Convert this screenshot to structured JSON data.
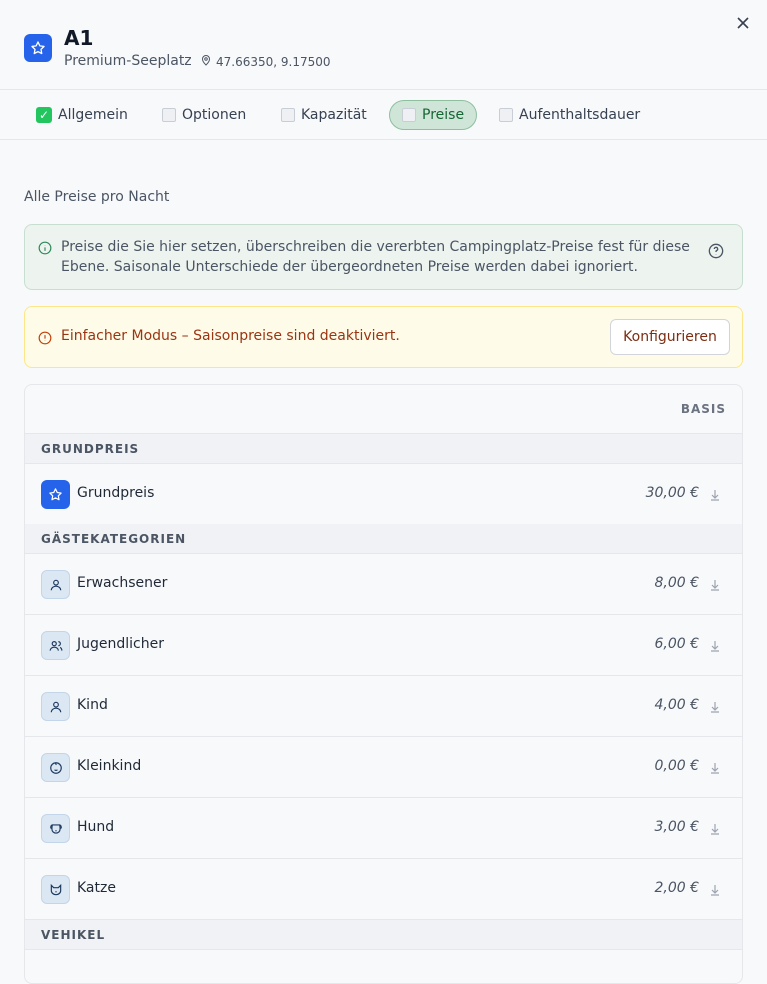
{
  "header": {
    "title": "A1",
    "subtitle": "Premium-Seeplatz",
    "coordinates": "47.66350, 9.17500",
    "accent_color": "#2563eb"
  },
  "tabs": [
    {
      "label": "Allgemein",
      "status": "complete",
      "icon": "check-icon"
    },
    {
      "label": "Optionen",
      "status": "incomplete",
      "icon": "box-icon"
    },
    {
      "label": "Kapazität",
      "status": "incomplete",
      "icon": "box-icon"
    },
    {
      "label": "Preise",
      "status": "active",
      "icon": "box-icon"
    },
    {
      "label": "Aufenthaltsdauer",
      "status": "incomplete",
      "icon": "box-icon"
    }
  ],
  "main": {
    "section_title": "Alle Preise pro Nacht",
    "info_text": "Preise die Sie hier setzen, überschreiben die vererbten Campingplatz-Preise fest für diese Ebene. Saisonale Unterschiede der übergeordneten Preise werden dabei ignoriert.",
    "warning_text": "Einfacher Modus – Saisonpreise sind deaktiviert.",
    "configure_label": "Konfigurieren"
  },
  "table": {
    "column_header": "BASIS",
    "groups": [
      {
        "title": "GRUNDPREIS",
        "rows": [
          {
            "label": "Grundpreis",
            "price": "30,00 €",
            "icon": "star-icon"
          }
        ]
      },
      {
        "title": "GÄSTEKATEGORIEN",
        "rows": [
          {
            "label": "Erwachsener",
            "price": "8,00 €",
            "icon": "person-icon"
          },
          {
            "label": "Jugendlicher",
            "price": "6,00 €",
            "icon": "people-icon"
          },
          {
            "label": "Kind",
            "price": "4,00 €",
            "icon": "person-icon"
          },
          {
            "label": "Kleinkind",
            "price": "0,00 €",
            "icon": "baby-icon"
          },
          {
            "label": "Hund",
            "price": "3,00 €",
            "icon": "dog-icon"
          },
          {
            "label": "Katze",
            "price": "2,00 €",
            "icon": "cat-icon"
          }
        ]
      },
      {
        "title": "VEHIKEL",
        "rows": []
      }
    ]
  }
}
